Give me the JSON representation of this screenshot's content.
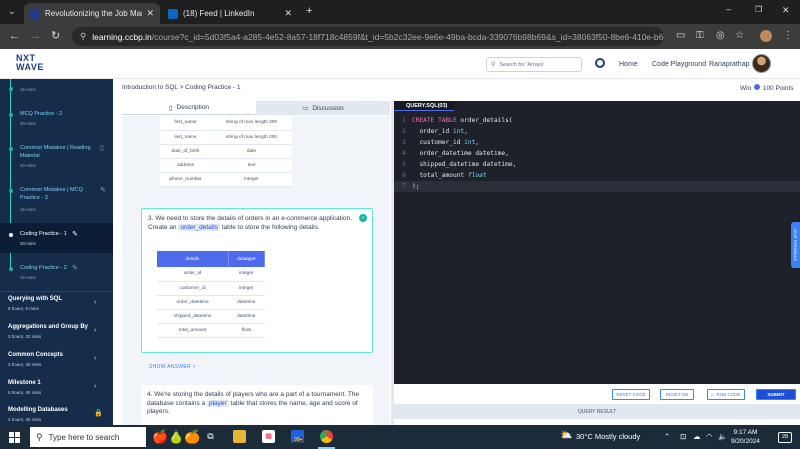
{
  "browser": {
    "tabs": [
      {
        "title": "Revolutionizing the Job Market",
        "close": "✕"
      },
      {
        "title": "(18) Feed | LinkedIn",
        "close": "✕"
      }
    ],
    "new_tab": "+",
    "url_host": "learning.ccbp.in",
    "url_path": "/course?c_id=5d03f5a4-a285-4e52-8a57-18f718c4859f&t_id=5b2c32ee-9e6e-49ba-bcda-339076b98b69&s_id=38063f50-8be6-410e-b603-73..."
  },
  "header": {
    "logo_line1": "NXT",
    "logo_line2": "WAVE",
    "search_placeholder": "Search for 'Arrays'",
    "home": "Home",
    "code_playground": "Code Playground",
    "username": "Ranaprathap"
  },
  "sidebar": {
    "items": [
      {
        "label": "",
        "meta": "15 mins"
      },
      {
        "label": "MCQ Practice - 2",
        "meta": "20 mins"
      },
      {
        "label": "Common Mistakes | Reading Material",
        "meta": "40 mins"
      },
      {
        "label": "Common Mistakes | MCQ Practice - 3",
        "meta": "15 mins"
      },
      {
        "label": "Coding Practice - 1",
        "meta": "30 mins"
      },
      {
        "label": "Coding Practice - 2",
        "meta": "15 mins"
      }
    ],
    "sections": [
      {
        "label": "Querying with SQL",
        "meta": "8 hours, 5 mins"
      },
      {
        "label": "Aggregations and Group By",
        "meta": "3 hours, 20 mins"
      },
      {
        "label": "Common Concepts",
        "meta": "3 hours, 40 mins"
      },
      {
        "label": "Milestone 1",
        "meta": "5 hours, 40 mins"
      },
      {
        "label": "Modelling Databases",
        "meta": "4 hours, 40 mins"
      }
    ]
  },
  "breadcrumb": "Introduction to SQL > Coding Practice - 1",
  "win_label": "Win",
  "win_points": "100 Points",
  "panel_tabs": {
    "description": "Description",
    "discussion": "Discussion"
  },
  "prev_table": {
    "rows": [
      [
        "first_name",
        "string of max length 200"
      ],
      [
        "last_name",
        "string of max length 200"
      ],
      [
        "date_of_birth",
        "date"
      ],
      [
        "address",
        "text"
      ],
      [
        "phone_number",
        "integer"
      ]
    ]
  },
  "question3": {
    "number": "3.",
    "text_before": "We need to store the details of orders in an e-commerce application. Create an",
    "table_name": "order_details",
    "text_after": "table to store the following details.",
    "headers": [
      "details",
      "datatype"
    ],
    "rows": [
      [
        "order_id",
        "integer"
      ],
      [
        "customer_id",
        "integer"
      ],
      [
        "order_datetime",
        "datetime"
      ],
      [
        "shipped_datetime",
        "datetime"
      ],
      [
        "total_amount",
        "float"
      ]
    ]
  },
  "show_answer": "SHOW ANSWER >",
  "question4": {
    "number": "4.",
    "text_before": "We're storing the details of players who are a part of a tournament. The database contains a",
    "table_name": "player",
    "text_after": "table that stores the name, age and score of players."
  },
  "editor": {
    "file_tab": "QUERY.SQL(03)",
    "lines": [
      "1",
      "2",
      "3",
      "4",
      "5",
      "6",
      "7"
    ],
    "code": {
      "l1_kw": "CREATE TABLE",
      "l1_rest": " order_details(",
      "l2_name": "  order_id ",
      "l2_type": "int",
      "l3_name": "  customer_id ",
      "l3_type": "int",
      "l4": "  order_datetime datetime,",
      "l5": "  shipped_datetime datetime,",
      "l6_name": "  total_amount ",
      "l6_type": "float",
      "l7": ");"
    }
  },
  "feedback": "GIVE FEEDBACK",
  "controls": {
    "reset_code": "RESET CODE",
    "reset_db": "RESET DB",
    "run_code": "RUN CODE",
    "submit": "SUBMIT"
  },
  "query_result": "QUERY RESULT",
  "taskbar": {
    "search_placeholder": "Type here to search",
    "badge": "99+",
    "weather": "30°C  Mostly cloudy",
    "time": "9:17 AM",
    "date": "9/20/2024",
    "notifications": "28"
  },
  "colors": {
    "accent": "#4f6bed",
    "teal": "#14b8a6",
    "sidebar": "#152c4a",
    "editor": "#1e2129"
  }
}
